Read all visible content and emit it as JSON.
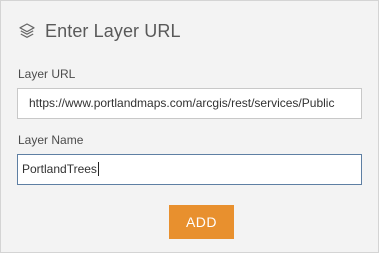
{
  "header": {
    "icon": "layers-icon",
    "title": "Enter Layer URL"
  },
  "layer_url": {
    "label": "Layer URL",
    "value": "https://www.portlandmaps.com/arcgis/rest/services/Public"
  },
  "layer_name": {
    "label": "Layer Name",
    "value": "PortlandTrees"
  },
  "actions": {
    "add_label": "ADD"
  },
  "colors": {
    "panel_background": "#f3f3f3",
    "add_button": "#e8902e",
    "focused_border": "#5e7fa3"
  }
}
